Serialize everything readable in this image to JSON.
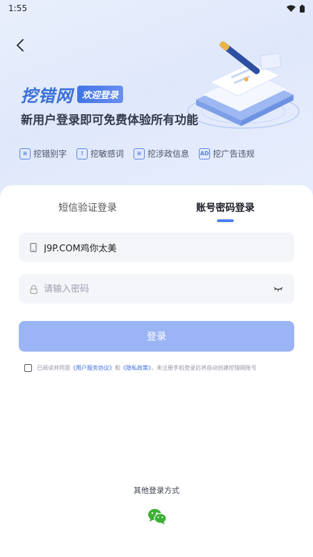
{
  "status_bar": {
    "time": "1:55"
  },
  "hero": {
    "brand_name": "挖错网",
    "brand_tag": "欢迎登录",
    "slogan": "新用户登录即可免费体验所有功能",
    "features": [
      {
        "icon": "document-check-icon",
        "label": "挖错别字"
      },
      {
        "icon": "document-warning-icon",
        "label": "挖敏感词"
      },
      {
        "icon": "document-gov-icon",
        "label": "挖涉政信息"
      },
      {
        "icon": "ad-icon",
        "icon_text": "AD",
        "label": "挖广告违规"
      }
    ]
  },
  "tabs": {
    "sms_label": "短信验证登录",
    "password_label": "账号密码登录",
    "active": "password"
  },
  "form": {
    "account_value": "J9P.COM鸡你太美",
    "password_placeholder": "请输入密码",
    "login_label": "登录"
  },
  "agreement": {
    "prefix": "已阅读并同意",
    "user_service": "《用户服务协议》",
    "and": "和",
    "privacy": "《隐私政策》",
    "suffix": "，未注册手机登录后将自动创建挖错网账号"
  },
  "other_login": {
    "label": "其他登录方式",
    "wechat_icon": "wechat-icon"
  },
  "colors": {
    "accent": "#4a7cf0",
    "button": "#9bb4f5",
    "link": "#3d6ee0"
  }
}
